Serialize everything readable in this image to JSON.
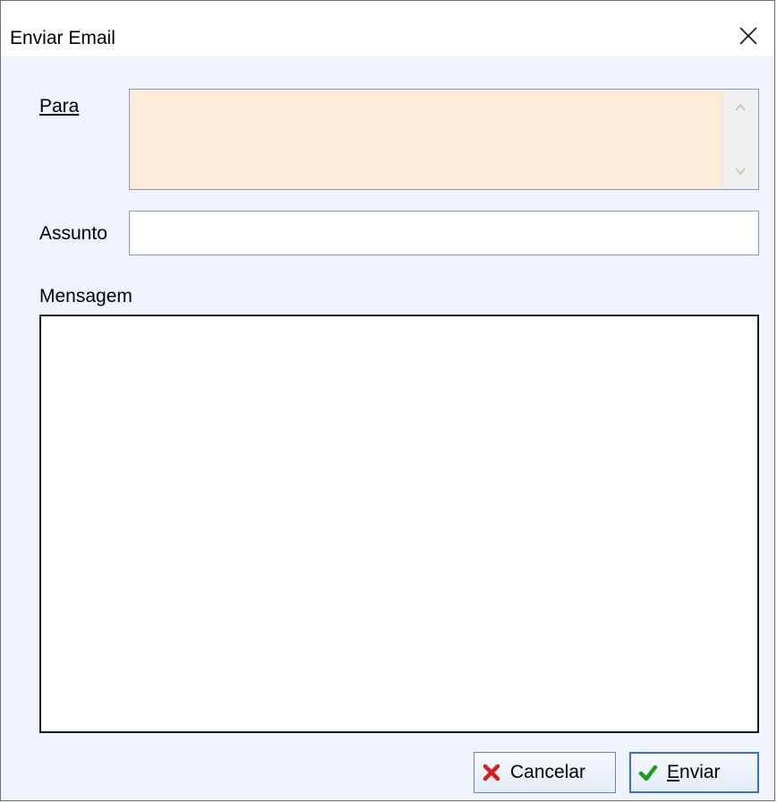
{
  "window": {
    "title": "Enviar Email"
  },
  "form": {
    "to_label": "Para",
    "to_value": "",
    "subject_label": "Assunto",
    "subject_value": "",
    "message_label": "Mensagem",
    "message_value": ""
  },
  "buttons": {
    "cancel_label": "Cancelar",
    "send_label": "Enviar"
  },
  "icons": {
    "close": "close-icon",
    "cancel": "red-x-icon",
    "send": "green-check-icon",
    "scroll_up": "chevron-up-icon",
    "scroll_down": "chevron-down-icon"
  },
  "colors": {
    "dialog_background": "#eef3fd",
    "to_field_background": "#fcecd8",
    "cancel_icon": "#d21f1f",
    "send_icon": "#1d9c1d",
    "button_border": "#6a86b3"
  }
}
